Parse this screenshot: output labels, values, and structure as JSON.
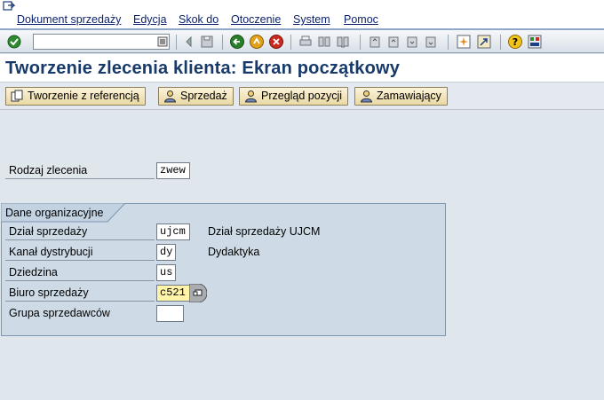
{
  "menu": [
    {
      "label": "Dokument sprzedaży"
    },
    {
      "label": "Edycja"
    },
    {
      "label": "Skok do"
    },
    {
      "label": "Otoczenie"
    },
    {
      "label": "System"
    },
    {
      "label": "Pomoc"
    }
  ],
  "title": "Tworzenie zlecenia klienta: Ekran początkowy",
  "app_buttons": [
    {
      "label": "Tworzenie z referencją"
    },
    {
      "label": "Sprzedaż"
    },
    {
      "label": "Przegląd pozycji"
    },
    {
      "label": "Zamawiający"
    }
  ],
  "order_type": {
    "label": "Rodzaj zlecenia",
    "value": "zwew"
  },
  "org_group": {
    "title": "Dane organizacyjne",
    "fields": [
      {
        "label": "Dział sprzedaży",
        "value": "ujcm",
        "desc": "Dział sprzedaży UJCM"
      },
      {
        "label": "Kanał dystrybucji",
        "value": "dy",
        "desc": "Dydaktyka"
      },
      {
        "label": "Dziedzina",
        "value": "us",
        "desc": ""
      },
      {
        "label": "Biuro sprzedaży",
        "value": "c521",
        "desc": ""
      },
      {
        "label": "Grupa sprzedawców",
        "value": "",
        "desc": ""
      }
    ]
  },
  "colors": {
    "focused_field": "#fff4a8",
    "title": "#173a6b"
  }
}
